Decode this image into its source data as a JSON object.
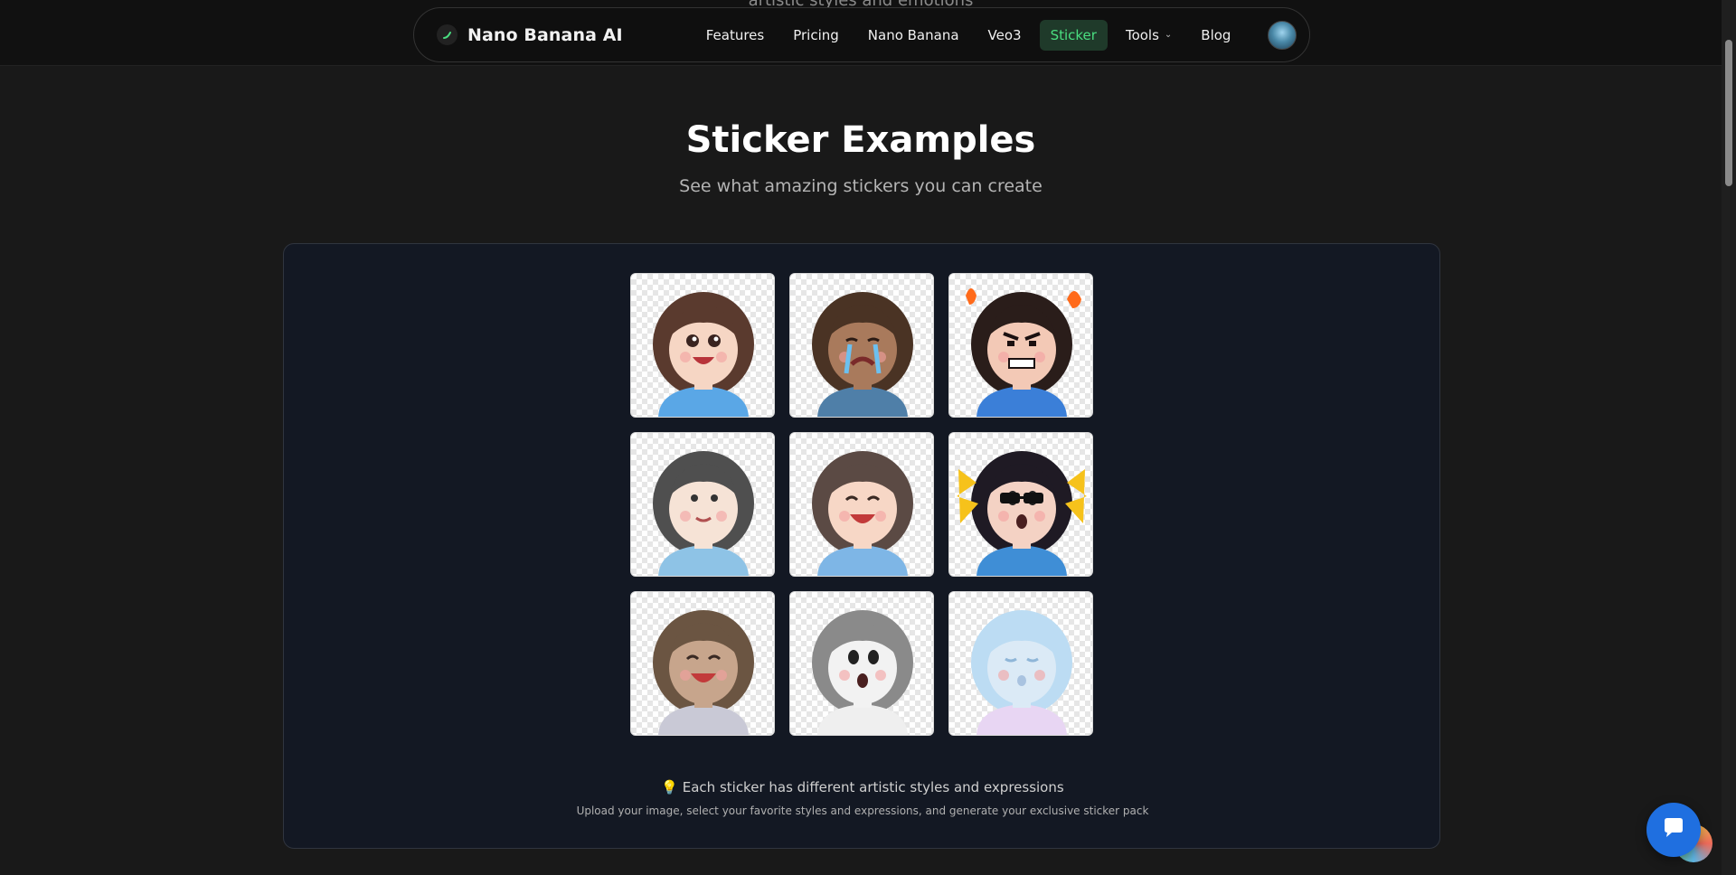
{
  "page": {
    "cut_off_text": "artistic styles and emotions",
    "title": "Sticker Examples",
    "subtitle": "See what amazing stickers you can create"
  },
  "nav": {
    "brand": "Nano Banana AI",
    "items": [
      {
        "label": "Features",
        "active": false
      },
      {
        "label": "Pricing",
        "active": false
      },
      {
        "label": "Nano Banana",
        "active": false
      },
      {
        "label": "Veo3",
        "active": false
      },
      {
        "label": "Sticker",
        "active": true
      },
      {
        "label": "Tools",
        "active": false,
        "dropdown": true
      },
      {
        "label": "Blog",
        "active": false
      }
    ],
    "avatar_icon": "user-avatar"
  },
  "stickers": [
    {
      "style": "chibi-happy",
      "skin": "#f6d6c4",
      "hair": "#5a3a2e",
      "shirt": "#5aa7e6",
      "expression": "happy"
    },
    {
      "style": "realistic-crying",
      "skin": "#a97a5c",
      "hair": "#4a3324",
      "shirt": "#4f7fa8",
      "expression": "crying"
    },
    {
      "style": "pixel-angry",
      "skin": "#f3c9b6",
      "hair": "#2a1d1a",
      "shirt": "#3b7fd8",
      "expression": "angry"
    },
    {
      "style": "watercolor",
      "skin": "#f6e3d6",
      "hair": "#4f4f4f",
      "shirt": "#8ec3e6",
      "expression": "smile"
    },
    {
      "style": "cartoon-laughing",
      "skin": "#f7d7c6",
      "hair": "#5b4a44",
      "shirt": "#7eb6e6",
      "expression": "laugh"
    },
    {
      "style": "pop-art-cool",
      "skin": "#f4d2c4",
      "hair": "#1f1a24",
      "shirt": "#3f8ed6",
      "expression": "surprised"
    },
    {
      "style": "holographic-chrome",
      "skin": "#c7a58c",
      "hair": "#6b5542",
      "shirt": "#c9c9d6",
      "expression": "laugh"
    },
    {
      "style": "pencil-sketch",
      "skin": "#f2f2f2",
      "hair": "#8a8a8a",
      "shirt": "#efefef",
      "expression": "surprised"
    },
    {
      "style": "pastel-iridescent",
      "skin": "#dbeaf6",
      "hair": "#bcdcf3",
      "shirt": "#e8d6f3",
      "expression": "sleepy"
    }
  ],
  "info": {
    "tip_icon": "lightbulb-icon",
    "tip_text": "💡 Each sticker has different artistic styles and expressions",
    "tip_subtext": "Upload your image, select your favorite styles and expressions, and generate your exclusive sticker pack"
  },
  "widgets": {
    "chat_icon": "chat-bubble-icon",
    "colors": {
      "accent": "#4ade80",
      "chat": "#1f6fe0",
      "panel_bg": "#131823"
    }
  }
}
